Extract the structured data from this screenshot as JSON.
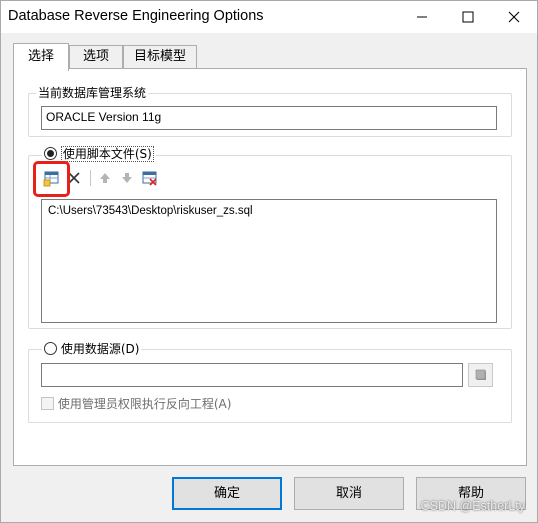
{
  "window": {
    "title": "Database Reverse Engineering Options"
  },
  "tabs": [
    {
      "label": "选择"
    },
    {
      "label": "选项"
    },
    {
      "label": "目标模型"
    }
  ],
  "dbms_group": {
    "legend": "当前数据库管理系统",
    "value": "ORACLE Version 11g"
  },
  "script_group": {
    "radio_label": "使用脚本文件(S)",
    "files": [
      "C:\\Users\\73543\\Desktop\\riskuser_zs.sql"
    ]
  },
  "datasource_group": {
    "radio_label": "使用数据源(D)",
    "value": "",
    "admin_checkbox_label": "使用管理员权限执行反向工程(A)"
  },
  "buttons": {
    "ok": "确定",
    "cancel": "取消",
    "help": "帮助"
  },
  "watermark": "CSDN @EstherLty",
  "colors": {
    "highlight_box": "#e8201a",
    "default_button_border": "#0078d7"
  }
}
